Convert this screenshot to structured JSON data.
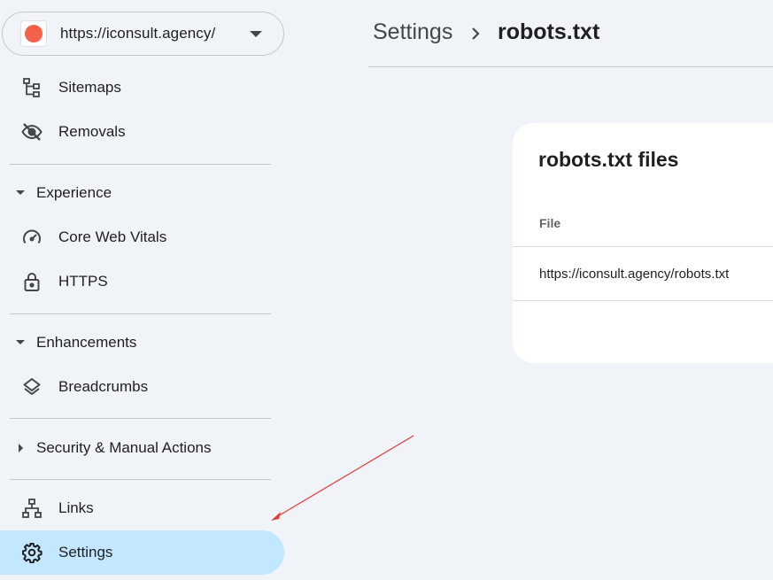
{
  "property": {
    "url": "https://iconsult.agency/",
    "favicon_color": "#f4614b"
  },
  "sidebar": {
    "items_top": [
      {
        "label": "Sitemaps",
        "icon": "sitemap-icon"
      },
      {
        "label": "Removals",
        "icon": "eye-off-icon"
      }
    ],
    "sections": [
      {
        "label": "Experience",
        "expanded": true,
        "items": [
          {
            "label": "Core Web Vitals",
            "icon": "speedometer-icon"
          },
          {
            "label": "HTTPS",
            "icon": "lock-icon"
          }
        ]
      },
      {
        "label": "Enhancements",
        "expanded": true,
        "items": [
          {
            "label": "Breadcrumbs",
            "icon": "layers-icon"
          }
        ]
      },
      {
        "label": "Security & Manual Actions",
        "expanded": false,
        "items": []
      }
    ],
    "items_bottom": [
      {
        "label": "Links",
        "icon": "links-icon"
      },
      {
        "label": "Settings",
        "icon": "gear-icon",
        "active": true
      }
    ]
  },
  "breadcrumb": {
    "parent": "Settings",
    "current": "robots.txt"
  },
  "card": {
    "title": "robots.txt files",
    "column_header": "File",
    "rows": [
      {
        "file": "https://iconsult.agency/robots.txt"
      }
    ]
  },
  "colors": {
    "background": "#f0f4f9",
    "active_item": "#c2e7ff",
    "annotation_arrow": "#e53935"
  }
}
